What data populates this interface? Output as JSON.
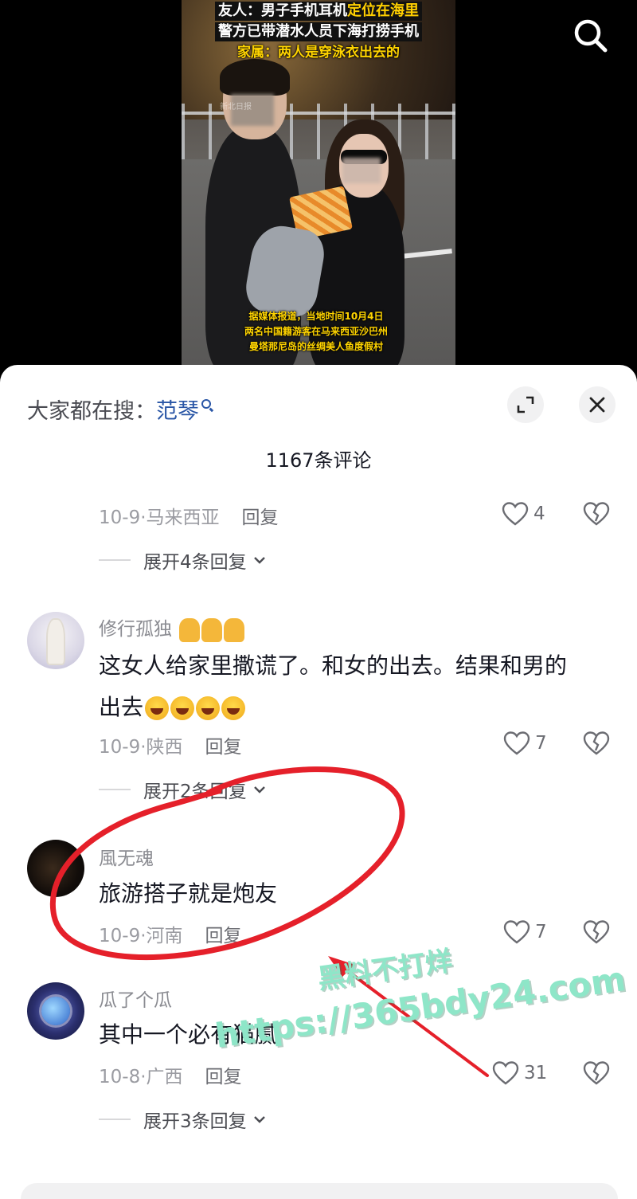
{
  "video": {
    "headline": {
      "line1_prefix": "友人：男子手机耳机",
      "line1_highlight": "定位在海里",
      "line2": "警方已带潜水人员下海打捞手机",
      "line3": "家属：两人是穿泳衣出去的"
    },
    "source_mark": "新北日报",
    "caption": [
      "据媒体报道，当地时间10月4日",
      "两名中国籍游客在马来西亚沙巴州",
      "曼塔那尼岛的丝绸美人鱼度假村"
    ],
    "search_icon": "search-icon"
  },
  "sheet": {
    "hot_search_label": "大家都在搜：",
    "hot_search_term": "范琴",
    "comment_count": "1167条评论",
    "icons": {
      "expand": "expand-icon",
      "close": "close-icon"
    }
  },
  "comments": [
    {
      "date": "10-9·",
      "location": "马来西亚",
      "reply": "回复",
      "likes": "4",
      "expand": "展开4条回复"
    },
    {
      "username": "修行孤独",
      "text_line1": "这女人给家里撒谎了。和女的出去。结果和男的",
      "text_line2": "出去",
      "date": "10-9·",
      "location": "陕西",
      "reply": "回复",
      "likes": "7",
      "expand": "展开2条回复"
    },
    {
      "username": "風无魂",
      "text": "旅游搭子就是炮友",
      "date": "10-9·",
      "location": "河南",
      "reply": "回复",
      "likes": "7"
    },
    {
      "username": "瓜了个瓜",
      "text": "其中一个必有猫腻",
      "date": "10-8·",
      "location": "广西",
      "reply": "回复",
      "likes": "31",
      "expand": "展开3条回复"
    }
  ],
  "overlay": {
    "watermark_line1": "黑料不打烊",
    "watermark_line2": "https://365bdy24.com",
    "annotation_color": "#e5202a",
    "watermark_color": "#8ee6c8"
  }
}
